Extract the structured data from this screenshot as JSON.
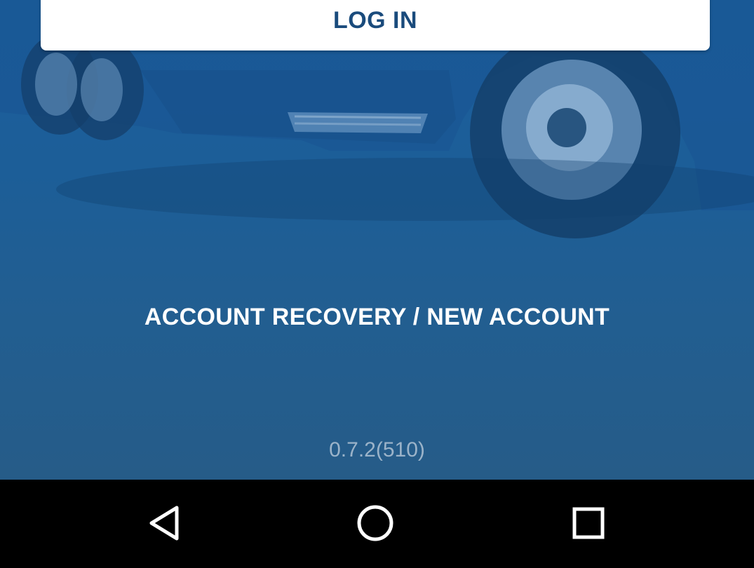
{
  "login": {
    "label": "LOG IN"
  },
  "links": {
    "recovery_label": "ACCOUNT RECOVERY / NEW ACCOUNT"
  },
  "footer": {
    "version": "0.7.2(510)"
  },
  "nav": {
    "back_icon": "triangle-back-icon",
    "home_icon": "circle-home-icon",
    "recents_icon": "square-recents-icon"
  },
  "colors": {
    "background_blue": "#1c5e98",
    "login_text": "#1a4b7c",
    "version_text": "#9bb3c9",
    "nav_bar": "#000000"
  }
}
